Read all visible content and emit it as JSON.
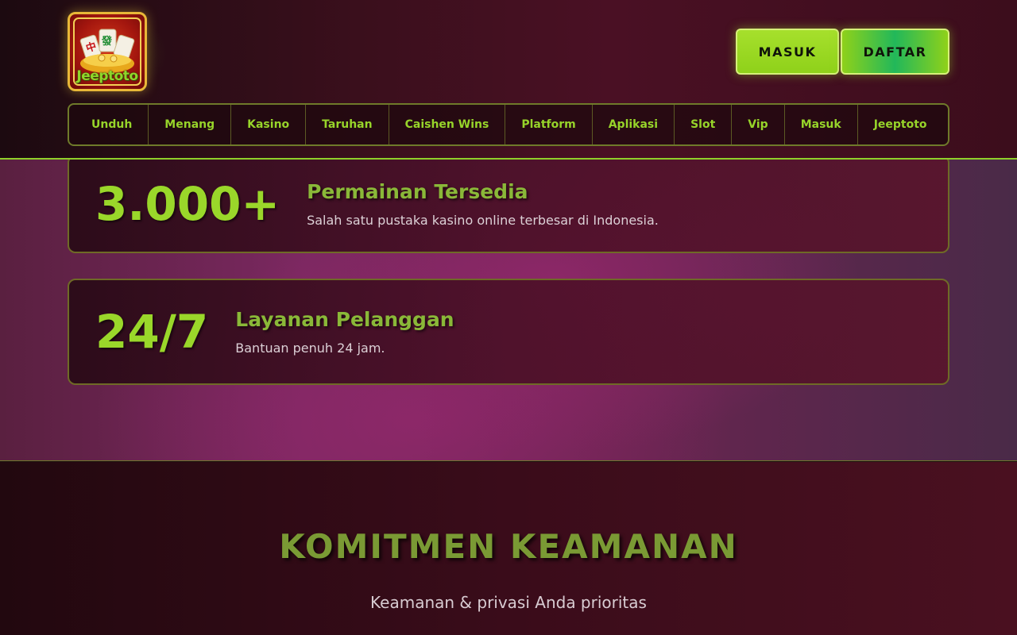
{
  "header": {
    "logo_text": "Jeeptoto",
    "login_label": "MASUK",
    "register_label": "DAFTAR"
  },
  "nav": {
    "items": [
      {
        "label": "Unduh"
      },
      {
        "label": "Menang"
      },
      {
        "label": "Kasino"
      },
      {
        "label": "Taruhan"
      },
      {
        "label": "Caishen Wins"
      },
      {
        "label": "Platform"
      },
      {
        "label": "Aplikasi"
      },
      {
        "label": "Slot"
      },
      {
        "label": "Vip"
      },
      {
        "label": "Masuk"
      },
      {
        "label": "Jeeptoto"
      }
    ]
  },
  "stats": [
    {
      "value": "3.000+",
      "title": "Permainan Tersedia",
      "desc": "Salah satu pustaka kasino online terbesar di Indonesia."
    },
    {
      "value": "24/7",
      "title": "Layanan Pelanggan",
      "desc": "Bantuan penuh 24 jam."
    }
  ],
  "security": {
    "title": "KOMITMEN KEAMANAN",
    "subtitle": "Keamanan & privasi Anda prioritas"
  },
  "colors": {
    "accent": "#97d42a",
    "header_bg": "#3a0f1c",
    "main_bg": "#7a2860"
  }
}
